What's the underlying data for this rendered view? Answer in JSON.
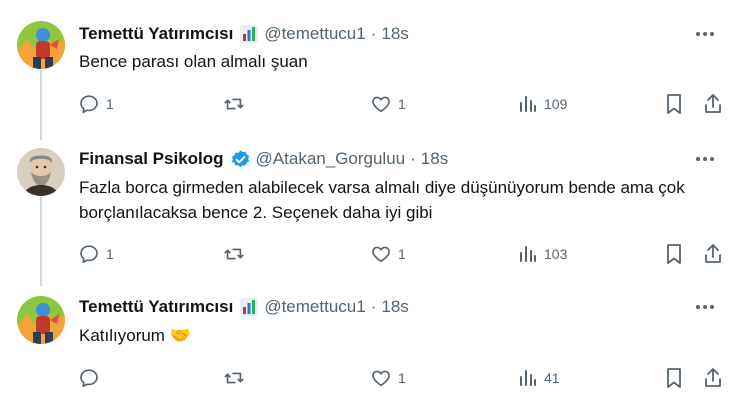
{
  "tweets": [
    {
      "author_name": "Temettü Yatırımcısı",
      "handle": "@temettucu1",
      "separator": "·",
      "time": "18s",
      "text": "Bence parası olan almalı şuan",
      "replies": "1",
      "retweets": "",
      "likes": "1",
      "views": "109",
      "badge_icon": "bar-chart-emoji",
      "avatar": "dragon-cartoon-avatar"
    },
    {
      "author_name": "Finansal Psikolog",
      "handle": "@Atakan_Gorguluu",
      "separator": "·",
      "time": "18s",
      "text": "Fazla borca girmeden alabilecek varsa almalı diye düşünüyorum bende ama çok borçlanılacaksa bence 2. Seçenek daha iyi gibi",
      "replies": "1",
      "retweets": "",
      "likes": "1",
      "views": "103",
      "badge_icon": "verified-badge",
      "avatar": "bearded-man-painting-avatar"
    },
    {
      "author_name": "Temettü Yatırımcısı",
      "handle": "@temettucu1",
      "separator": "·",
      "time": "18s",
      "text": "Katılıyorum 🤝",
      "replies": "",
      "retweets": "",
      "likes": "1",
      "views": "41",
      "badge_icon": "bar-chart-emoji",
      "avatar": "dragon-cartoon-avatar"
    }
  ],
  "colors": {
    "text_primary": "#0f1419",
    "text_secondary": "#536471",
    "verified_blue": "#1d9bf0",
    "thread_line": "#cfd9de"
  }
}
